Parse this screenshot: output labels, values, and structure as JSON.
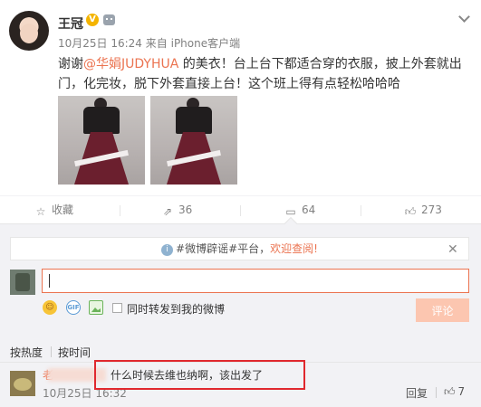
{
  "post": {
    "author": "王冠",
    "verified_badge": "V",
    "time": "10月25日 16:24",
    "source_prefix": "来自",
    "source": "iPhone客户端",
    "text_before": "谢谢",
    "mention": "@华娟JUDYHUA",
    "text_after": " 的美衣！台上台下都适合穿的衣服，披上外套就出门，化完妆，脱下外套直接上台！这个班上得有点轻松哈哈哈",
    "image_count": 2
  },
  "actions": {
    "favorite": {
      "label": "收藏",
      "icon": "star-icon"
    },
    "repost": {
      "count": "36",
      "icon": "repost-icon"
    },
    "comment": {
      "count": "64",
      "icon": "comment-icon"
    },
    "like": {
      "count": "273",
      "icon": "thumbs-up-icon"
    }
  },
  "comments": {
    "notice": {
      "tag": "#微博辟谣#平台，",
      "link": "欢迎查阅!"
    },
    "input": {
      "value": "",
      "placeholder": ""
    },
    "repost_checkbox_label": "同时转发到我的微博",
    "submit_label": "评论",
    "sort": {
      "hot": "按热度",
      "time": "按时间"
    },
    "items": [
      {
        "user": "老",
        "text": "什么时候去维也纳啊，该出发了",
        "time": "10月25日 16:32",
        "reply_label": "回复",
        "likes": "7"
      }
    ]
  },
  "colors": {
    "accent": "#eb7350",
    "highlight_box": "#e0282e",
    "panel_bg": "#f2f2f5"
  }
}
